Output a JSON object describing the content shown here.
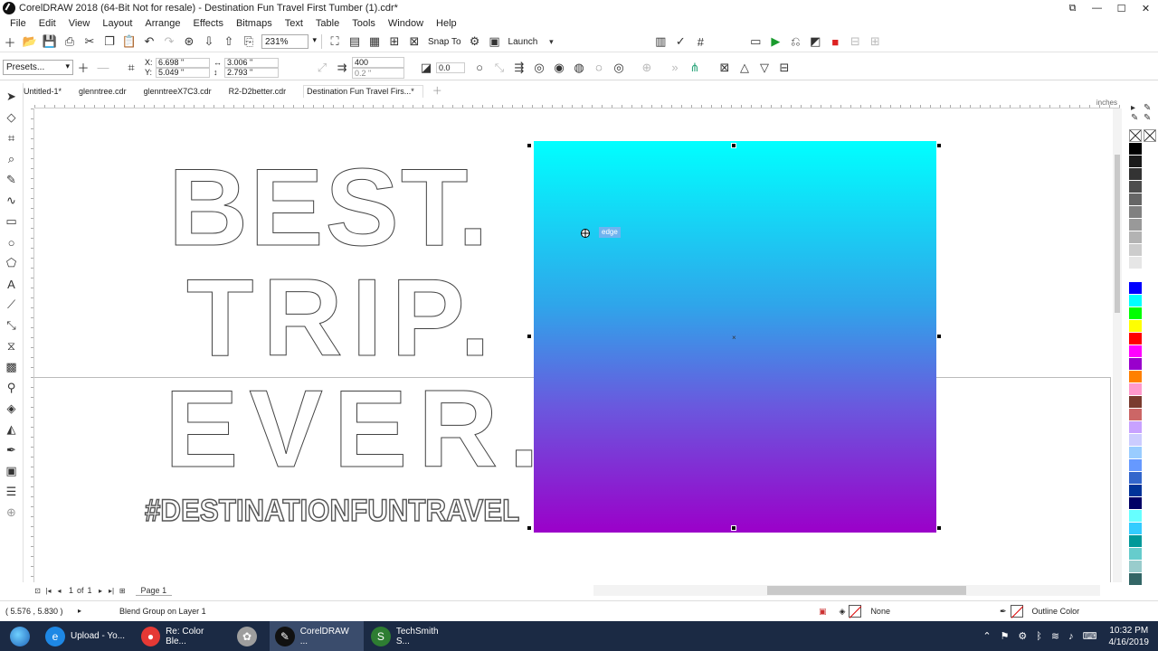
{
  "window": {
    "title": "CorelDRAW 2018 (64-Bit Not for resale) - Destination Fun Travel First Tumber (1).cdr*",
    "controls": [
      "⧉",
      "—",
      "☐",
      "✕"
    ]
  },
  "menu": [
    "File",
    "Edit",
    "View",
    "Layout",
    "Arrange",
    "Effects",
    "Bitmaps",
    "Text",
    "Table",
    "Tools",
    "Window",
    "Help"
  ],
  "toolbar": {
    "zoom": "231%",
    "snap_label": "Snap To",
    "launch_label": "Launch"
  },
  "propbar": {
    "presets": "Presets...",
    "x": "6.698 \"",
    "y": "5.049 \"",
    "w": "3.006 \"",
    "h": "2.793 \"",
    "steps": "400",
    "spacing": "0.2 \"",
    "angle": "0.0"
  },
  "tabs": [
    "Untitled-1*",
    "glenntree.cdr",
    "glenntreeX7C3.cdr",
    "R2-D2better.cdr",
    "Destination Fun Travel Firs...*"
  ],
  "ruler_units": "inches",
  "artwork": {
    "line1": "BEST.",
    "line2": "TRIP.",
    "line3": "EVER.",
    "hashtag": "#DESTINATIONFUNTRAVEL",
    "gradient_top": "#00ffff",
    "gradient_bottom": "#9b00c9",
    "snap_tip": "edge"
  },
  "palette": [
    "#000000",
    "#1a1a1a",
    "#333333",
    "#4d4d4d",
    "#666666",
    "#808080",
    "#999999",
    "#b3b3b3",
    "#cccccc",
    "#e6e6e6",
    "#ffffff",
    "#0000ff",
    "#00ffff",
    "#00ff00",
    "#ffff00",
    "#ff0000",
    "#ff00ff",
    "#9900cc",
    "#ff8000",
    "#ff99cc",
    "#7a3b2e",
    "#cc6666",
    "#c8a2ff",
    "#ccccff",
    "#99ccff",
    "#6699ff",
    "#3366cc",
    "#003399",
    "#000066",
    "#66ffff",
    "#33ccff",
    "#009999",
    "#66cccc",
    "#99cccc",
    "#336666"
  ],
  "pagenav": {
    "current": "1",
    "of": "of",
    "total": "1",
    "page_tab": "Page 1"
  },
  "status": {
    "cursor": "( 5.576 , 5.830 )",
    "object": "Blend Group on Layer 1",
    "fill": "None",
    "outline": "Outline Color"
  },
  "taskbar": {
    "tasks": [
      {
        "label": "Upload - Yo...",
        "icon": "e",
        "color": "#1e88e5"
      },
      {
        "label": "Re: Color Ble...",
        "icon": "●",
        "color": "#e53935"
      },
      {
        "label": "",
        "icon": "✿",
        "color": "#9e9e9e"
      },
      {
        "label": "CorelDRAW ...",
        "icon": "✎",
        "color": "#111111"
      },
      {
        "label": "TechSmith S...",
        "icon": "S",
        "color": "#2e7d32"
      }
    ],
    "time": "10:32 PM",
    "date": "4/16/2019"
  }
}
